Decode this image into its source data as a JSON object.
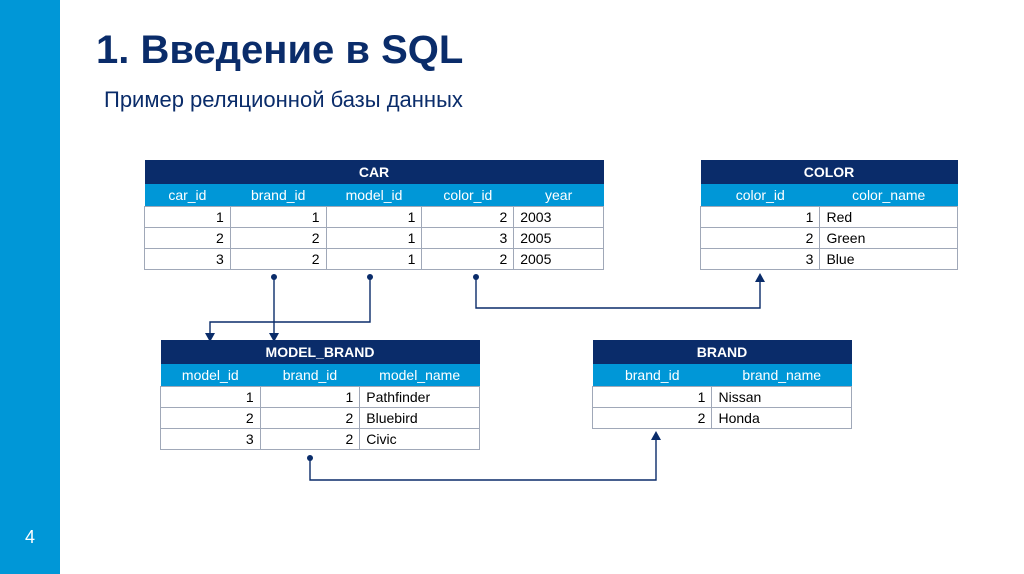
{
  "page_number": "4",
  "title": "1. Введение в SQL",
  "subtitle": "Пример реляционной базы данных",
  "tables": {
    "car": {
      "name": "CAR",
      "columns": [
        "car_id",
        "brand_id",
        "model_id",
        "color_id",
        "year"
      ],
      "rows": [
        [
          "1",
          "1",
          "1",
          "2",
          "2003"
        ],
        [
          "2",
          "2",
          "1",
          "3",
          "2005"
        ],
        [
          "3",
          "2",
          "1",
          "2",
          "2005"
        ]
      ]
    },
    "color": {
      "name": "COLOR",
      "columns": [
        "color_id",
        "color_name"
      ],
      "rows": [
        [
          "1",
          "Red"
        ],
        [
          "2",
          "Green"
        ],
        [
          "3",
          "Blue"
        ]
      ]
    },
    "model_brand": {
      "name": "MODEL_BRAND",
      "columns": [
        "model_id",
        "brand_id",
        "model_name"
      ],
      "rows": [
        [
          "1",
          "1",
          "Pathfinder"
        ],
        [
          "2",
          "2",
          "Bluebird"
        ],
        [
          "3",
          "2",
          "Civic"
        ]
      ]
    },
    "brand": {
      "name": "BRAND",
      "columns": [
        "brand_id",
        "brand_name"
      ],
      "rows": [
        [
          "1",
          "Nissan"
        ],
        [
          "2",
          "Honda"
        ]
      ]
    }
  },
  "relationships": [
    {
      "from": "CAR.color_id",
      "to": "COLOR.color_id"
    },
    {
      "from": "CAR.brand_id",
      "to": "MODEL_BRAND.brand_id"
    },
    {
      "from": "CAR.model_id",
      "to": "MODEL_BRAND.model_id"
    },
    {
      "from": "MODEL_BRAND.brand_id",
      "to": "BRAND.brand_id"
    }
  ]
}
